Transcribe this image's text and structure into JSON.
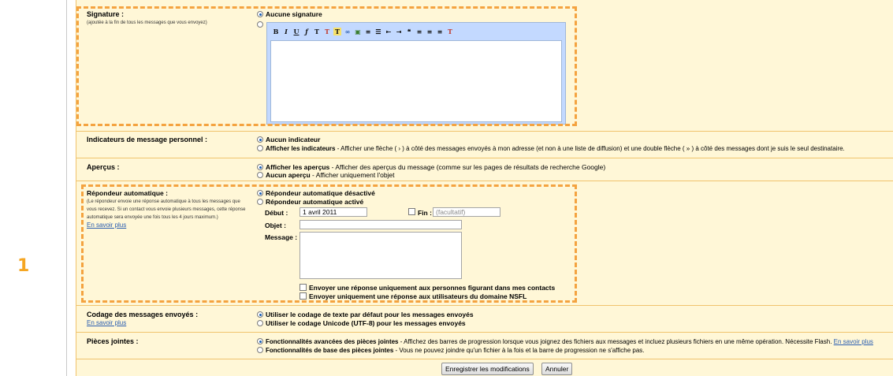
{
  "step": "1",
  "signature": {
    "label": "Signature :",
    "sublabel": "(ajoutée à la fin de tous les messages que vous envoyez)",
    "opt_none": "Aucune signature"
  },
  "toolbar_icons": [
    "bold-icon",
    "italic-icon",
    "underline-icon",
    "font-icon",
    "font-size-icon",
    "text-color-icon",
    "highlight-icon",
    "link-icon",
    "image-icon",
    "numbered-list-icon",
    "bulleted-list-icon",
    "outdent-icon",
    "indent-icon",
    "quote-icon",
    "align-left-icon",
    "align-center-icon",
    "align-right-icon",
    "remove-formatting-icon"
  ],
  "indicators": {
    "label": "Indicateurs de message personnel :",
    "opt1": "Aucun indicateur",
    "opt2_bold": "Afficher les indicateurs",
    "opt2_desc": " - Afficher une flèche ( › ) à côté des messages envoyés à mon adresse (et non à une liste de diffusion) et une double flèche ( » ) à côté des messages dont je suis le seul destinataire."
  },
  "previews": {
    "label": "Aperçus :",
    "opt1_bold": "Afficher les aperçus",
    "opt1_desc": " - Afficher des aperçus du message (comme sur les pages de résultats de recherche Google)",
    "opt2_bold": "Aucun aperçu",
    "opt2_desc": " - Afficher uniquement l'objet"
  },
  "autoreply": {
    "label": "Répondeur automatique :",
    "sublabel1": "(Le répondeur envoie une réponse automatique à tous les messages que",
    "sublabel2": "vous recevez. Si un contact vous envoie plusieurs messages, cette réponse",
    "sublabel3": "automatique sera envoyée une fois tous les 4 jours maximum.)",
    "learn_more": "En savoir plus",
    "opt_off": "Répondeur automatique désactivé",
    "opt_on": "Répondeur automatique activé",
    "start_label": "Début :",
    "start_value": "1 avril 2011",
    "end_label": "Fin :",
    "end_placeholder": "(facultatif)",
    "subject_label": "Objet :",
    "message_label": "Message :",
    "check_contacts": "Envoyer une réponse uniquement aux personnes figurant dans mes contacts",
    "check_domain": "Envoyer uniquement une réponse aux utilisateurs du domaine NSFL"
  },
  "encoding": {
    "label": "Codage des messages envoyés :",
    "learn_more": "En savoir plus",
    "opt1": "Utiliser le codage de texte par défaut pour les messages envoyés",
    "opt2": "Utiliser le codage Unicode (UTF-8) pour les messages envoyés"
  },
  "attachments": {
    "label": "Pièces jointes :",
    "opt1_bold": "Fonctionnalités avancées des pièces jointes",
    "opt1_desc": " - Affichez des barres de progression lorsque vous joignez des fichiers aux messages et incluez plusieurs fichiers en une même opération. Nécessite Flash. ",
    "opt1_link": "En savoir plus",
    "opt2_bold": "Fonctionnalités de base des pièces jointes",
    "opt2_desc": " - Vous ne pouvez joindre qu'un fichier à la fois et la barre de progression ne s'affiche pas."
  },
  "buttons": {
    "save": "Enregistrer les modifications",
    "cancel": "Annuler"
  },
  "colors": {
    "accent": "#f4a340",
    "panel": "#fff7d7",
    "link": "#2a5db0"
  }
}
